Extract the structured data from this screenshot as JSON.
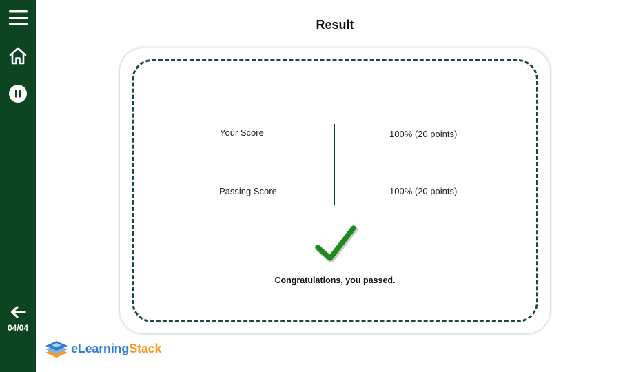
{
  "sidebar": {
    "menu_icon": "hamburger-menu-icon",
    "home_icon": "home-icon",
    "pause_icon": "pause-icon",
    "back_icon": "arrow-left-icon",
    "counter": "04/04",
    "background": "#0d4421"
  },
  "page": {
    "title": "Result"
  },
  "result": {
    "your_score_label": "Your Score",
    "your_score_value": "100% (20 points)",
    "passing_score_label": "Passing Score",
    "passing_score_value": "100% (20 points)",
    "status_icon": "checkmark-icon",
    "message": "Congratulations, you passed.",
    "check_color": "#1e8a1e",
    "border_color": "#1b4a3a"
  },
  "logo": {
    "part1": "eLearning",
    "part2": "Stack",
    "part1_color": "#2e7fd0",
    "part2_color": "#f59a23"
  }
}
